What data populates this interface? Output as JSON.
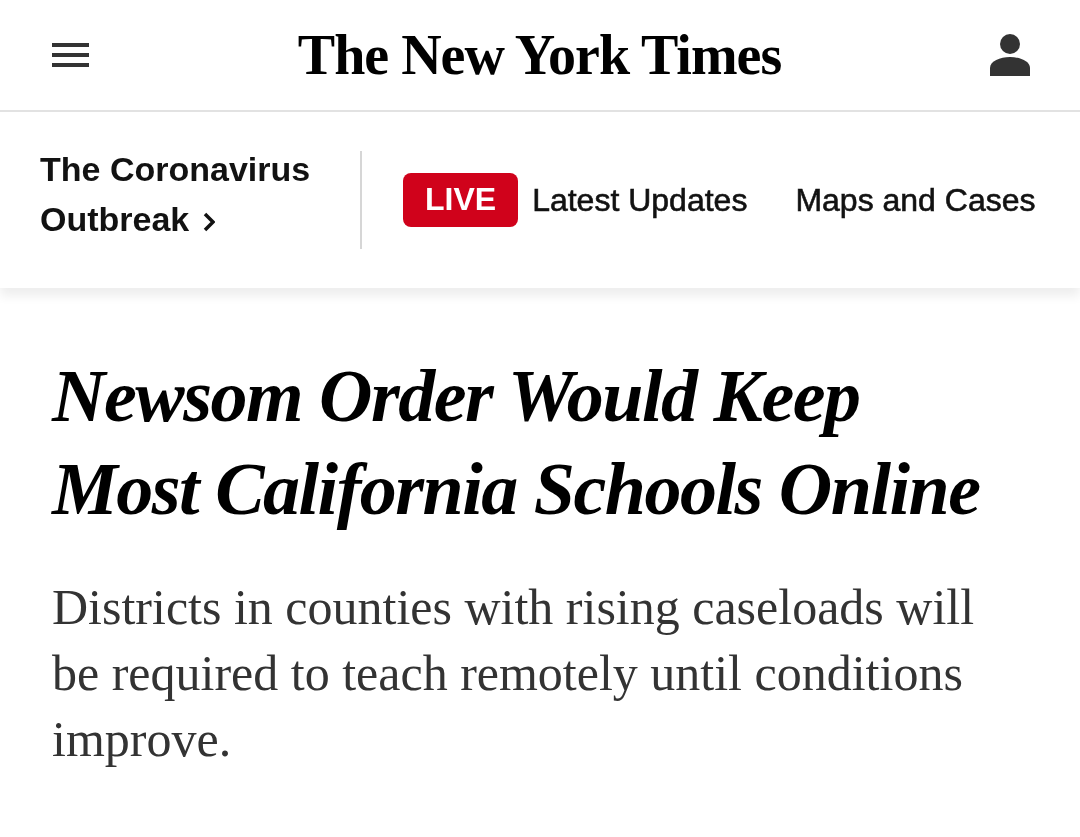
{
  "header": {
    "logo": "The New York Times"
  },
  "section_nav": {
    "section_link": "The Coronavirus Outbreak",
    "items": [
      {
        "kind": "live",
        "badge": "LIVE",
        "label": "Latest Updates"
      },
      {
        "kind": "link",
        "label": "Maps and Cases"
      }
    ]
  },
  "article": {
    "headline": "Newsom Order Would Keep Most California Schools Online",
    "summary": "Districts in counties with rising caseloads will be required to teach remotely until conditions improve."
  }
}
